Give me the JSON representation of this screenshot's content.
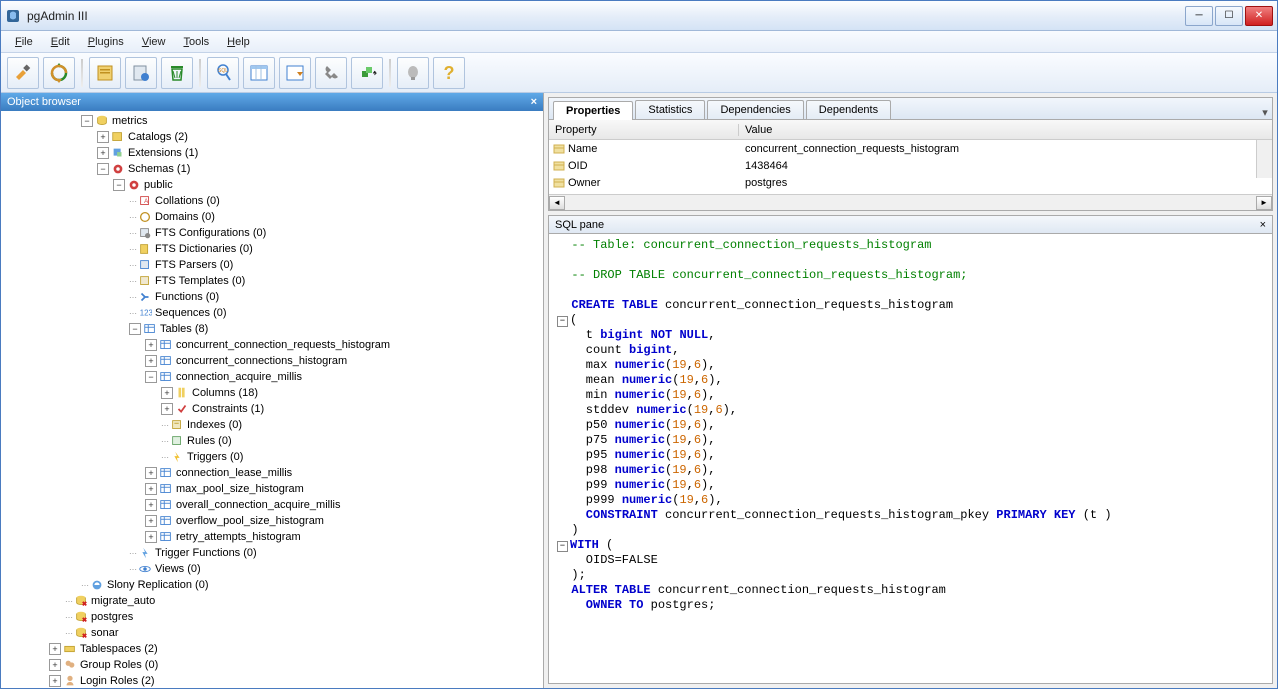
{
  "title": "pgAdmin III",
  "menu": [
    "File",
    "Edit",
    "Plugins",
    "View",
    "Tools",
    "Help"
  ],
  "object_browser_title": "Object browser",
  "tree": [
    {
      "indent": 5,
      "ex": "-",
      "icon": "db",
      "label": "metrics"
    },
    {
      "indent": 6,
      "ex": "+",
      "icon": "catalog",
      "label": "Catalogs (2)"
    },
    {
      "indent": 6,
      "ex": "+",
      "icon": "ext",
      "label": "Extensions (1)"
    },
    {
      "indent": 6,
      "ex": "-",
      "icon": "schema-grp",
      "label": "Schemas (1)"
    },
    {
      "indent": 7,
      "ex": "-",
      "icon": "schema",
      "label": "public"
    },
    {
      "indent": 8,
      "ex": "",
      "icon": "collation",
      "label": "Collations (0)"
    },
    {
      "indent": 8,
      "ex": "",
      "icon": "domain",
      "label": "Domains (0)"
    },
    {
      "indent": 8,
      "ex": "",
      "icon": "fts-cfg",
      "label": "FTS Configurations (0)"
    },
    {
      "indent": 8,
      "ex": "",
      "icon": "fts-dict",
      "label": "FTS Dictionaries (0)"
    },
    {
      "indent": 8,
      "ex": "",
      "icon": "fts-parser",
      "label": "FTS Parsers (0)"
    },
    {
      "indent": 8,
      "ex": "",
      "icon": "fts-tmpl",
      "label": "FTS Templates (0)"
    },
    {
      "indent": 8,
      "ex": "",
      "icon": "func",
      "label": "Functions (0)"
    },
    {
      "indent": 8,
      "ex": "",
      "icon": "seq",
      "label": "Sequences (0)"
    },
    {
      "indent": 8,
      "ex": "-",
      "icon": "tables",
      "label": "Tables (8)"
    },
    {
      "indent": 9,
      "ex": "+",
      "icon": "table",
      "label": "concurrent_connection_requests_histogram"
    },
    {
      "indent": 9,
      "ex": "+",
      "icon": "table",
      "label": "concurrent_connections_histogram"
    },
    {
      "indent": 9,
      "ex": "-",
      "icon": "table",
      "label": "connection_acquire_millis"
    },
    {
      "indent": 10,
      "ex": "+",
      "icon": "cols",
      "label": "Columns (18)"
    },
    {
      "indent": 10,
      "ex": "+",
      "icon": "constraint",
      "label": "Constraints (1)"
    },
    {
      "indent": 10,
      "ex": "",
      "icon": "index",
      "label": "Indexes (0)"
    },
    {
      "indent": 10,
      "ex": "",
      "icon": "rule",
      "label": "Rules (0)"
    },
    {
      "indent": 10,
      "ex": "",
      "icon": "trigger",
      "label": "Triggers (0)"
    },
    {
      "indent": 9,
      "ex": "+",
      "icon": "table",
      "label": "connection_lease_millis"
    },
    {
      "indent": 9,
      "ex": "+",
      "icon": "table",
      "label": "max_pool_size_histogram"
    },
    {
      "indent": 9,
      "ex": "+",
      "icon": "table",
      "label": "overall_connection_acquire_millis"
    },
    {
      "indent": 9,
      "ex": "+",
      "icon": "table",
      "label": "overflow_pool_size_histogram"
    },
    {
      "indent": 9,
      "ex": "+",
      "icon": "table",
      "label": "retry_attempts_histogram"
    },
    {
      "indent": 8,
      "ex": "",
      "icon": "trig-func",
      "label": "Trigger Functions (0)"
    },
    {
      "indent": 8,
      "ex": "",
      "icon": "view",
      "label": "Views (0)"
    },
    {
      "indent": 5,
      "ex": "",
      "icon": "slony",
      "label": "Slony Replication (0)"
    },
    {
      "indent": 4,
      "ex": "",
      "icon": "db-x",
      "label": "migrate_auto"
    },
    {
      "indent": 4,
      "ex": "",
      "icon": "db-x",
      "label": "postgres"
    },
    {
      "indent": 4,
      "ex": "",
      "icon": "db-x",
      "label": "sonar"
    },
    {
      "indent": 3,
      "ex": "+",
      "icon": "tablespace",
      "label": "Tablespaces (2)"
    },
    {
      "indent": 3,
      "ex": "+",
      "icon": "group-role",
      "label": "Group Roles (0)"
    },
    {
      "indent": 3,
      "ex": "+",
      "icon": "login-role",
      "label": "Login Roles (2)"
    }
  ],
  "tabs": [
    "Properties",
    "Statistics",
    "Dependencies",
    "Dependents"
  ],
  "active_tab": 0,
  "prop_headers": {
    "c1": "Property",
    "c2": "Value"
  },
  "properties": [
    {
      "k": "Name",
      "v": "concurrent_connection_requests_histogram"
    },
    {
      "k": "OID",
      "v": "1438464"
    },
    {
      "k": "Owner",
      "v": "postgres"
    }
  ],
  "sql_pane_title": "SQL pane",
  "sql": {
    "l1": "-- Table: concurrent_connection_requests_histogram",
    "l2": "-- DROP TABLE concurrent_connection_requests_histogram;",
    "l3a": "CREATE TABLE",
    "l3b": " concurrent_connection_requests_histogram",
    "l4": "(",
    "l5a": "  t ",
    "l5b": "bigint",
    "l5c": " NOT NULL",
    "l5d": ",",
    "l6a": "  count ",
    "l6b": "bigint",
    "l6c": ",",
    "cols": [
      {
        "name": "max",
        "type": "numeric",
        "p": "19",
        "s": "6"
      },
      {
        "name": "mean",
        "type": "numeric",
        "p": "19",
        "s": "6"
      },
      {
        "name": "min",
        "type": "numeric",
        "p": "19",
        "s": "6"
      },
      {
        "name": "stddev",
        "type": "numeric",
        "p": "19",
        "s": "6"
      },
      {
        "name": "p50",
        "type": "numeric",
        "p": "19",
        "s": "6"
      },
      {
        "name": "p75",
        "type": "numeric",
        "p": "19",
        "s": "6"
      },
      {
        "name": "p95",
        "type": "numeric",
        "p": "19",
        "s": "6"
      },
      {
        "name": "p98",
        "type": "numeric",
        "p": "19",
        "s": "6"
      },
      {
        "name": "p99",
        "type": "numeric",
        "p": "19",
        "s": "6"
      },
      {
        "name": "p999",
        "type": "numeric",
        "p": "19",
        "s": "6"
      }
    ],
    "lcona": "  CONSTRAINT",
    "lconb": " concurrent_connection_requests_histogram_pkey ",
    "lconc": "PRIMARY KEY",
    "lcond": " (t )",
    "lclose": ")",
    "lwitha": "WITH",
    "lwithb": " (",
    "loids": "  OIDS=FALSE",
    "lwithc": ");",
    "laltera": "ALTER TABLE",
    "lalterb": " concurrent_connection_requests_histogram",
    "lownera": "  OWNER TO",
    "lownerb": " postgres;"
  }
}
